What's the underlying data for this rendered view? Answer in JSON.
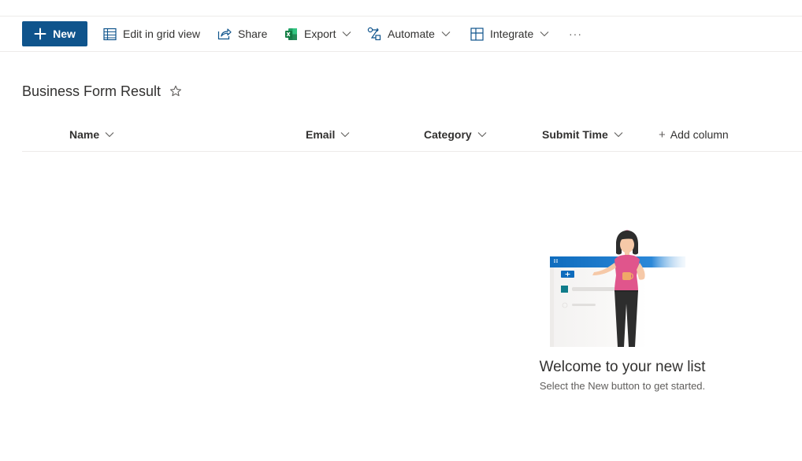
{
  "toolbar": {
    "new_label": "New",
    "edit_grid_label": "Edit in grid view",
    "share_label": "Share",
    "export_label": "Export",
    "automate_label": "Automate",
    "integrate_label": "Integrate",
    "more_label": "···"
  },
  "list": {
    "title": "Business Form Result"
  },
  "columns": {
    "name": "Name",
    "email": "Email",
    "category": "Category",
    "submit_time": "Submit Time",
    "add_column": "Add column"
  },
  "empty_state": {
    "heading": "Welcome to your new list",
    "subtext": "Select the New button to get started."
  },
  "colors": {
    "primary": "#0f548c",
    "excel_green": "#107c41",
    "illustration_blue": "#0f6cbd",
    "illustration_pink": "#e0558c"
  },
  "icons": {
    "new": "plus-icon",
    "edit_grid": "grid-icon",
    "share": "share-icon",
    "export": "excel-icon",
    "automate": "flow-icon",
    "integrate": "integrate-icon",
    "favorite": "star-icon"
  }
}
